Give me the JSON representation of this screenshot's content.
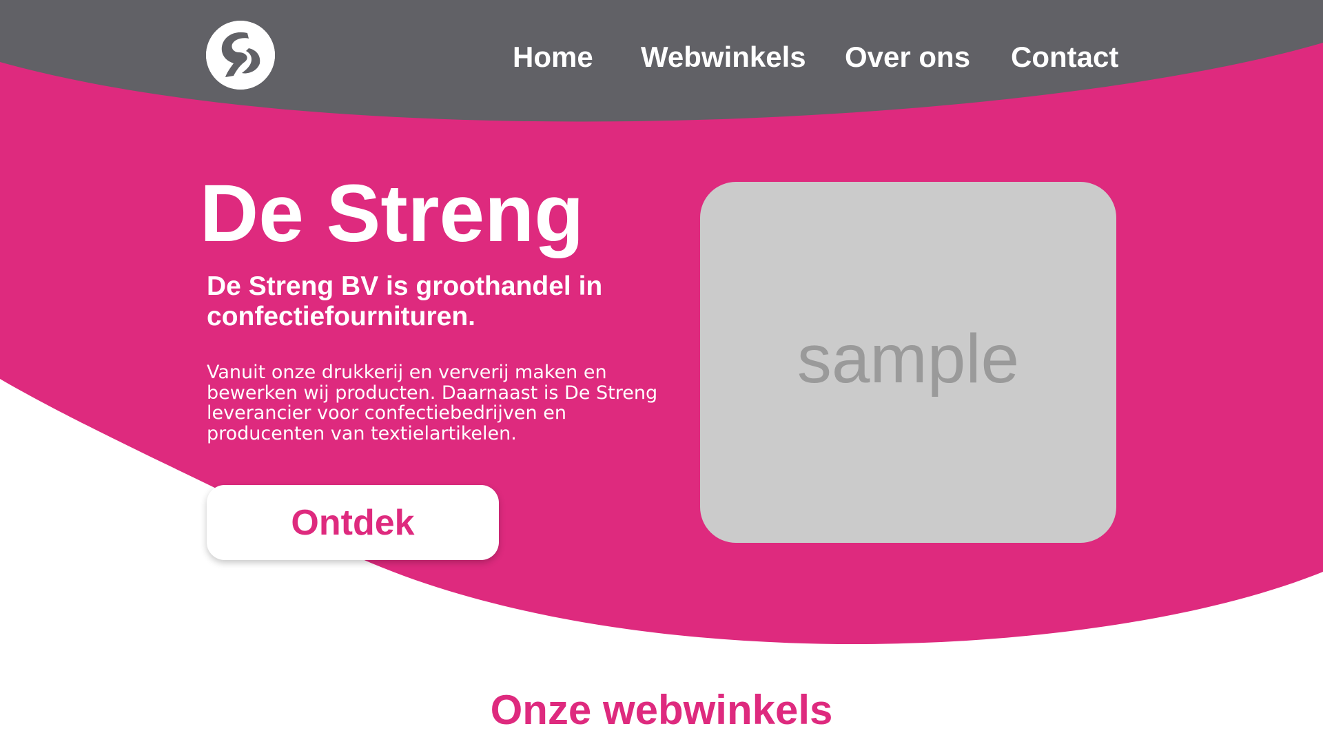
{
  "colors": {
    "header_gray": "#616166",
    "brand_pink": "#de2a7e",
    "white": "#ffffff",
    "placeholder_bg": "#cbcbcb",
    "placeholder_text": "#9a9a9a"
  },
  "header": {
    "logo_icon": "logo-icon",
    "nav": [
      {
        "label": "Home"
      },
      {
        "label": "Webwinkels"
      },
      {
        "label": "Over ons"
      },
      {
        "label": "Contact"
      }
    ]
  },
  "hero": {
    "title": "De Streng",
    "subtitle": "De Streng BV is groothandel in confectiefournituren.",
    "body": "Vanuit onze drukkerij en ververij maken en bewerken wij producten. Daarnaast is De Streng leverancier voor confectiebedrijven en producenten van textielartikelen.",
    "cta_label": "Ontdek",
    "image_label": "sample"
  },
  "section": {
    "title": "Onze webwinkels"
  }
}
